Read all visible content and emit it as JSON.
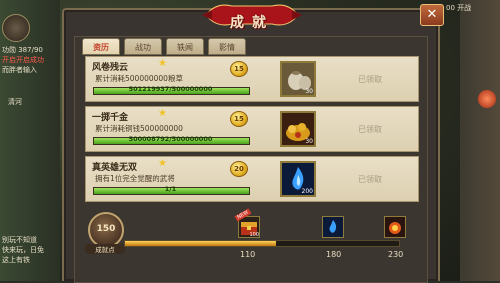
{
  "hud": {
    "left_lines": [
      "功勋 387/90",
      "开启开启成功",
      "而胖者输入"
    ],
    "chat_1": "清河",
    "chat_2": "别玩不知道",
    "chat_3": "快来玩，日免",
    "chat_4": "这上有铁",
    "top_right": "00 开战"
  },
  "dialog": {
    "title": "成就",
    "close_icon": "x-icon"
  },
  "tabs": [
    {
      "label": "资历",
      "active": true
    },
    {
      "label": "战功",
      "active": false
    },
    {
      "label": "轶闻",
      "active": false
    },
    {
      "label": "影情",
      "active": false
    }
  ],
  "achievements": [
    {
      "name": "风卷残云",
      "stars": "★",
      "description": "累计消耗500000000粮草",
      "progress_text": "501219937/500000000",
      "progress": 1.0,
      "points": "15",
      "reward_count": "30",
      "reward_icon": "grain-sack-icon",
      "status": "已领取"
    },
    {
      "name": "一掷千金",
      "stars": "★",
      "description": "累计消耗铜钱500000000",
      "progress_text": "500008792/500000000",
      "progress": 1.0,
      "points": "15",
      "reward_count": "30",
      "reward_icon": "gold-pile-icon",
      "status": "已领取"
    },
    {
      "name": "真英雄无双",
      "stars": "★",
      "description": "拥有1位完全觉醒的武将",
      "progress_text": "1/1",
      "progress": 1.0,
      "points": "20",
      "reward_count": "200",
      "reward_icon": "blue-flame-icon",
      "status": "已领取"
    }
  ],
  "bottom": {
    "score": "150",
    "score_label": "成就点",
    "progress": 0.55,
    "milestones": [
      {
        "value": "110",
        "count": "100",
        "icon": "treasure-chest-icon",
        "tag": "NEW"
      },
      {
        "value": "180",
        "count": "",
        "icon": "blue-flame-icon",
        "tag": ""
      },
      {
        "value": "230",
        "count": "",
        "icon": "fire-orb-icon",
        "tag": ""
      }
    ]
  },
  "colors": {
    "accent_red": "#c2452c",
    "progress_green": "#4aa21c",
    "progress_gold": "#c27a10"
  }
}
